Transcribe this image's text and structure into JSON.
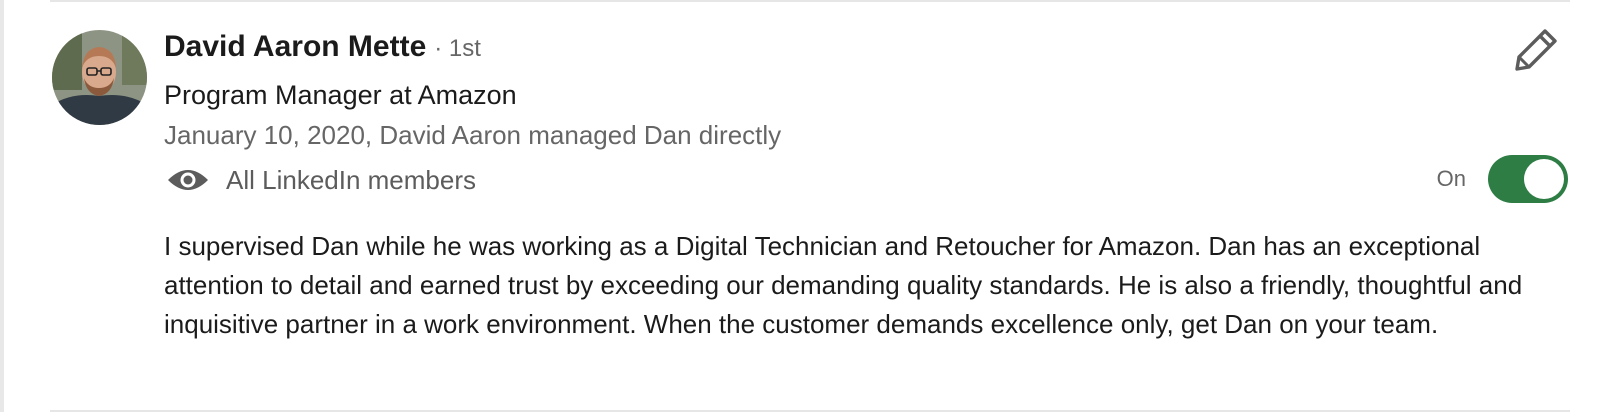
{
  "recommendation": {
    "author_name": "David Aaron Mette",
    "connection_degree": "· 1st",
    "headline": "Program Manager at Amazon",
    "relationship": "January 10, 2020, David Aaron managed Dan directly",
    "visibility": {
      "icon": "eye-icon",
      "label": "All LinkedIn members",
      "toggle_label": "On",
      "toggle_state": true,
      "toggle_color": "#2e7d45"
    },
    "edit_icon": "pencil-icon",
    "text": "I supervised Dan while he was working as a Digital Technician and Retoucher for Amazon. Dan has an exceptional attention to detail and earned trust by exceeding our demanding quality standards. He is also a friendly, thoughtful and inquisitive partner in a work environment. When the customer demands excellence only, get Dan on your team."
  }
}
